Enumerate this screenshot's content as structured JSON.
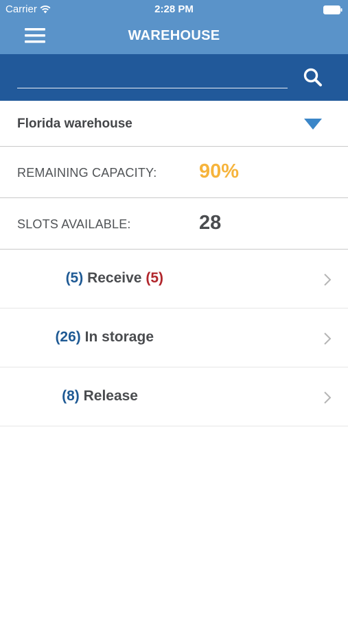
{
  "status_bar": {
    "carrier": "Carrier",
    "time": "2:28 PM"
  },
  "nav": {
    "title": "WAREHOUSE"
  },
  "search": {
    "value": "",
    "placeholder": ""
  },
  "warehouse": {
    "selected": "Florida warehouse"
  },
  "stats": {
    "capacity_label": "REMAINING CAPACITY:",
    "capacity_value": "90%",
    "slots_label": "SLOTS AVAILABLE:",
    "slots_value": "28"
  },
  "list": [
    {
      "count": "(5)",
      "label": "Receive",
      "badge": "(5)"
    },
    {
      "count": "(26)",
      "label": "In storage"
    },
    {
      "count": "(8)",
      "label": "Release"
    }
  ],
  "colors": {
    "header": "#5a93c9",
    "search_bar": "#21599a",
    "accent_orange": "#f6b43c",
    "count_blue": "#1f5a94",
    "badge_red": "#b1262c"
  },
  "icons": [
    "wifi-icon",
    "battery-icon",
    "menu-icon",
    "search-icon",
    "dropdown-caret-icon",
    "chevron-right-icon"
  ]
}
